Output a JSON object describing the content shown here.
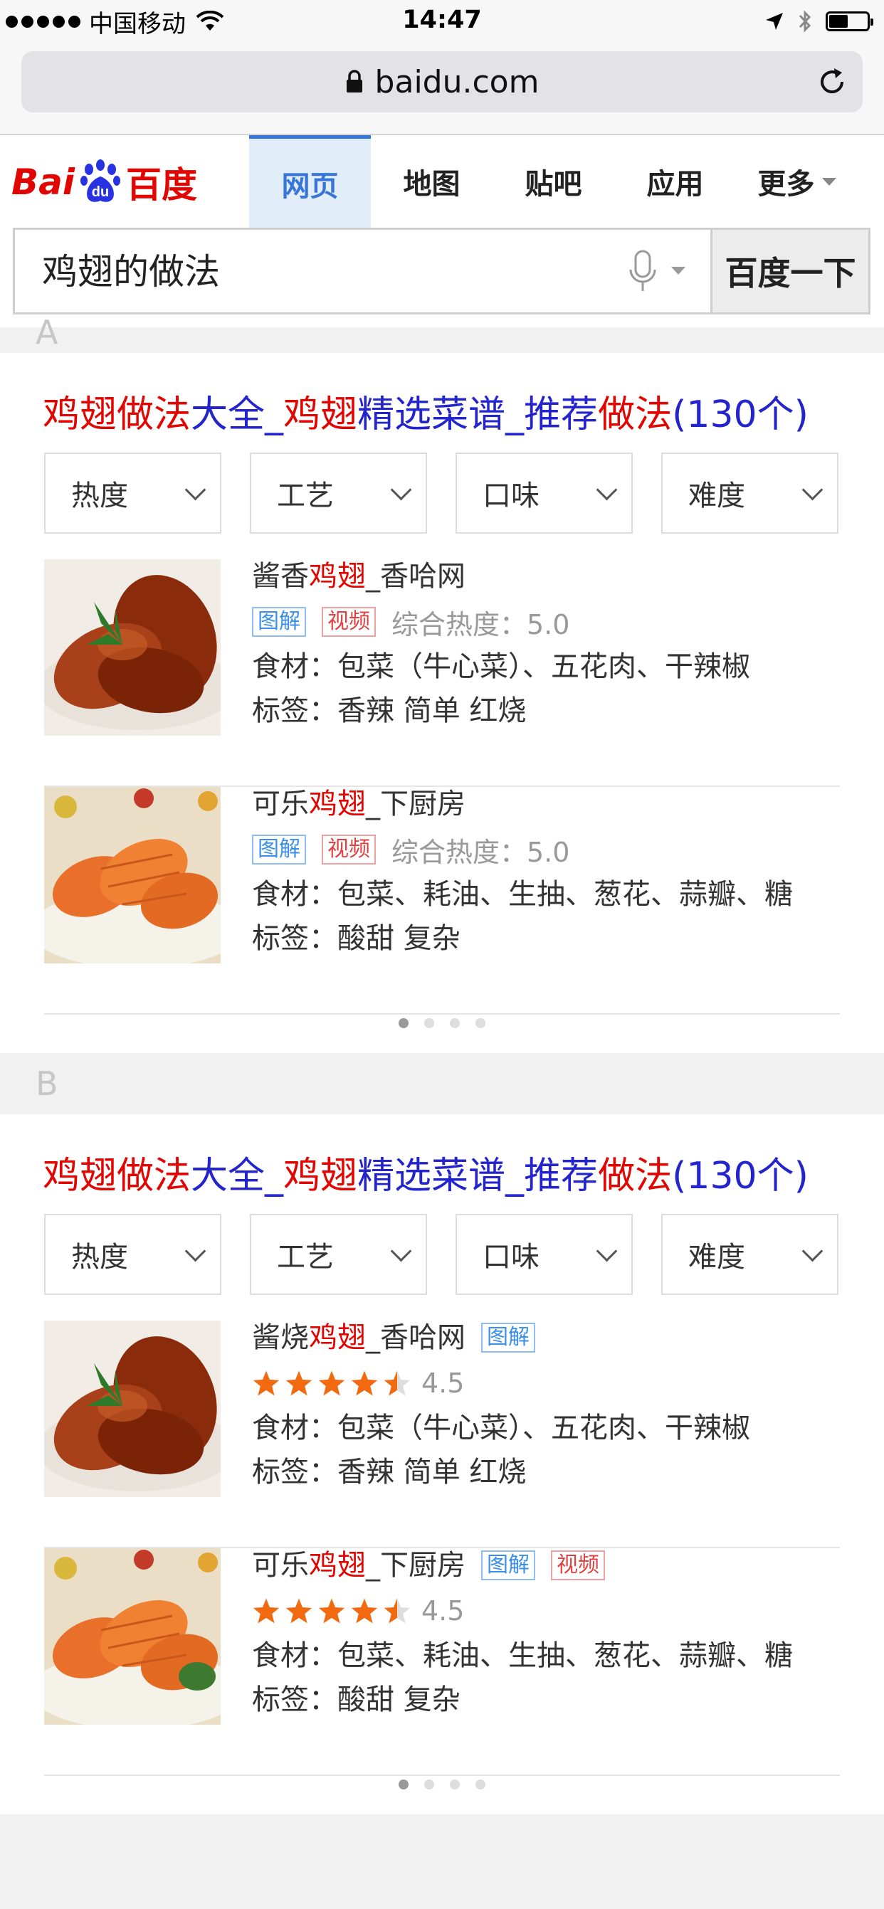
{
  "status_bar": {
    "carrier": "中国移动",
    "time": "14:47"
  },
  "browser": {
    "url": "baidu.com"
  },
  "header": {
    "logo_text_latin": "Bai",
    "logo_text_du": "du",
    "logo_text_cn": "百度",
    "tabs": [
      {
        "label": "网页",
        "active": true
      },
      {
        "label": "地图"
      },
      {
        "label": "贴吧"
      },
      {
        "label": "应用"
      },
      {
        "label": "更多"
      }
    ],
    "search_query": "鸡翅的做法",
    "search_button": "百度一下"
  },
  "sections": [
    {
      "label": "A",
      "title_parts": [
        "鸡翅做法",
        "大全_",
        "鸡翅",
        "精选菜谱_推荐",
        "做法",
        "(130个)"
      ],
      "filters": [
        "热度",
        "工艺",
        "口味",
        "难度"
      ],
      "items": [
        {
          "title_pre": "酱香",
          "title_hl": "鸡翅",
          "title_post": "_香哈网",
          "badges": [
            "图解",
            "视频"
          ],
          "heat": "综合热度：5.0",
          "ingredients": "食材：包菜（牛心菜）、五花肉、干辣椒",
          "tags": "标签：香辣  简单  红烧"
        },
        {
          "title_pre": "可乐",
          "title_hl": "鸡翅",
          "title_post": "_下厨房",
          "badges": [
            "图解",
            "视频"
          ],
          "heat": "综合热度：5.0",
          "ingredients": "食材：包菜、耗油、生抽、葱花、蒜瓣、糖",
          "tags": "标签：酸甜  复杂"
        }
      ],
      "pager": {
        "count": 4,
        "active": 1
      }
    },
    {
      "label": "B",
      "title_parts": [
        "鸡翅做法",
        "大全_",
        "鸡翅",
        "精选菜谱_推荐",
        "做法",
        "(130个)"
      ],
      "filters": [
        "热度",
        "工艺",
        "口味",
        "难度"
      ],
      "items": [
        {
          "title_pre": "酱烧",
          "title_hl": "鸡翅",
          "title_post": "_香哈网",
          "badges": [
            "图解"
          ],
          "rating": "4.5",
          "ingredients": "食材：包菜（牛心菜）、五花肉、干辣椒",
          "tags": "标签：香辣  简单  红烧"
        },
        {
          "title_pre": "可乐",
          "title_hl": "鸡翅",
          "title_post": "_下厨房",
          "badges": [
            "图解",
            "视频"
          ],
          "rating": "4.5",
          "ingredients": "食材：包菜、耗油、生抽、葱花、蒜瓣、糖",
          "tags": "标签：酸甜  复杂"
        }
      ],
      "pager": {
        "count": 4,
        "active": 1
      }
    }
  ],
  "colors": {
    "brand_red": "#e10602",
    "link_blue": "#2424cc",
    "tab_blue": "#3776d8",
    "star_orange": "#f26a10"
  }
}
